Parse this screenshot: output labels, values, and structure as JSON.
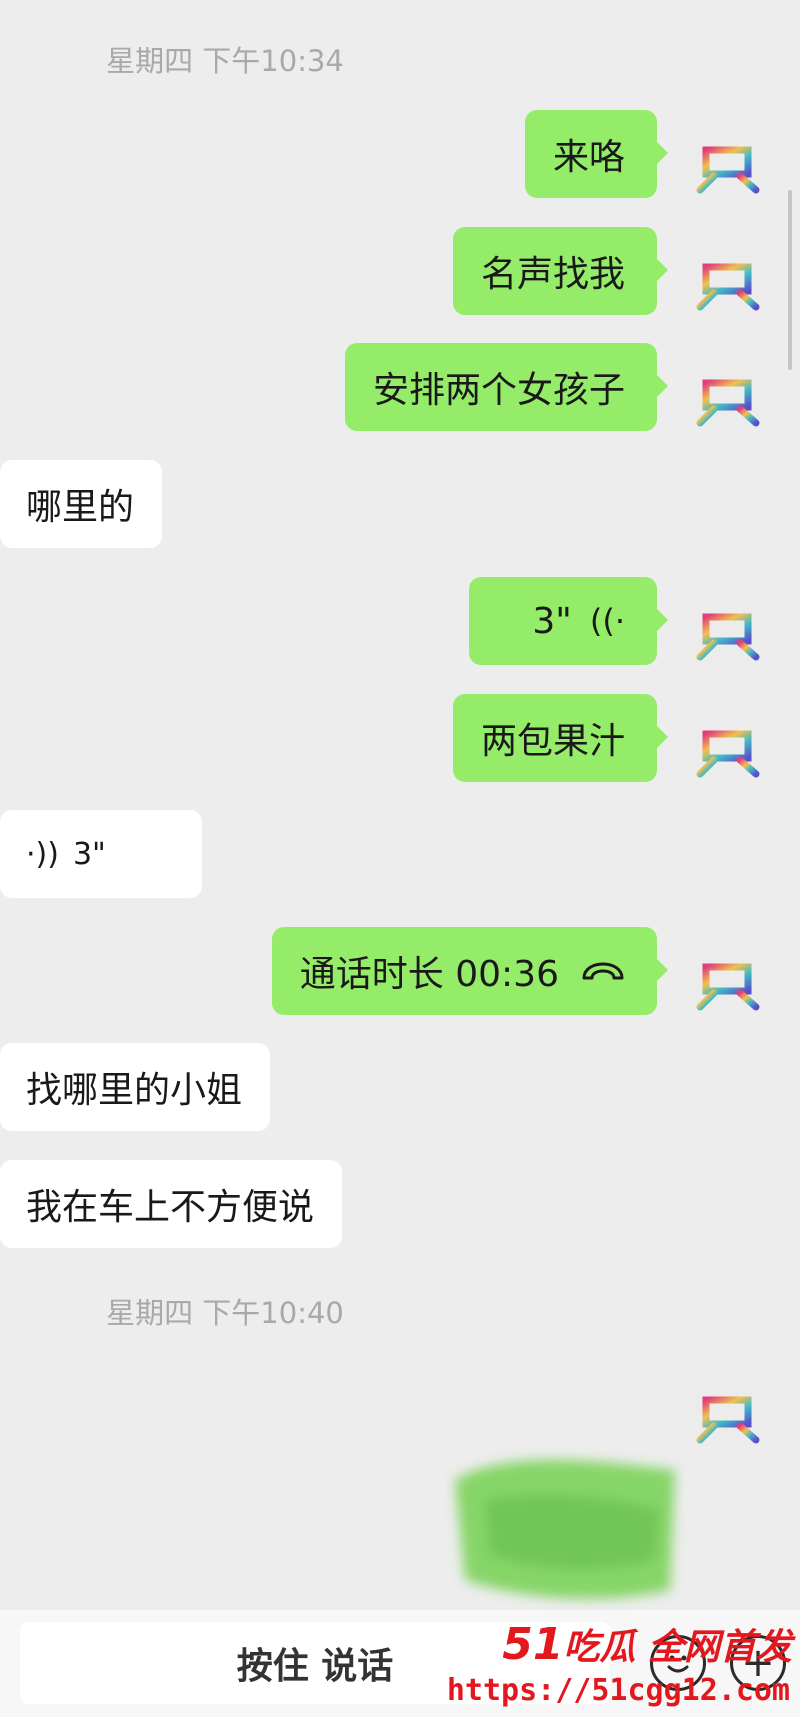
{
  "timestamps": [
    "星期四 下午10:34",
    "星期四 下午10:40"
  ],
  "messages": [
    {
      "side": "out",
      "text": "来咯"
    },
    {
      "side": "out",
      "text": "名声找我"
    },
    {
      "side": "out",
      "text": "安排两个女孩子"
    },
    {
      "side": "in",
      "text": "哪里的"
    },
    {
      "side": "out",
      "type": "voice",
      "duration": "3\"",
      "wave": "((·"
    },
    {
      "side": "out",
      "text": "两包果汁"
    },
    {
      "side": "in",
      "type": "voice",
      "duration": "3\"",
      "wave": "·))"
    },
    {
      "side": "out",
      "type": "call",
      "text": "通话时长 00:36"
    },
    {
      "side": "in",
      "text": "找哪里的小姐"
    },
    {
      "side": "in",
      "text": "我在车上不方便说"
    }
  ],
  "input_bar": {
    "hold_to_talk": "按住 说话",
    "emoji_icon": "smiley-icon",
    "plus_icon": "plus-icon",
    "plus_glyph": "+"
  },
  "watermark": {
    "num": "51",
    "text": "吃瓜 全网首发",
    "url": "https://51cgg12.com"
  },
  "colors": {
    "outgoing_bubble": "#95ec69",
    "incoming_bubble": "#ffffff",
    "background": "#ededed",
    "watermark": "#e3181f"
  }
}
